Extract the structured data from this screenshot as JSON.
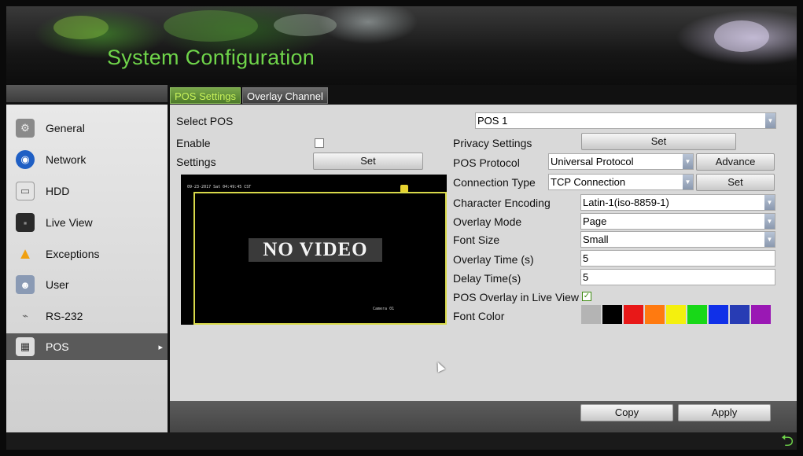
{
  "header": {
    "title": "System Configuration"
  },
  "tabs": [
    {
      "label": "POS Settings",
      "active": true
    },
    {
      "label": "Overlay Channel",
      "active": false
    }
  ],
  "sidebar": {
    "items": [
      {
        "label": "General",
        "icon": "general-icon"
      },
      {
        "label": "Network",
        "icon": "network-icon"
      },
      {
        "label": "HDD",
        "icon": "hdd-icon"
      },
      {
        "label": "Live View",
        "icon": "live-view-icon"
      },
      {
        "label": "Exceptions",
        "icon": "warning-icon"
      },
      {
        "label": "User",
        "icon": "user-icon"
      },
      {
        "label": "RS-232",
        "icon": "rs232-icon"
      },
      {
        "label": "POS",
        "icon": "pos-icon",
        "selected": true
      }
    ]
  },
  "left_form": {
    "select_pos_label": "Select POS",
    "enable_label": "Enable",
    "enable_checked": false,
    "settings_label": "Settings",
    "settings_button": "Set"
  },
  "pos_select": {
    "value": "POS 1"
  },
  "right_form": {
    "privacy_label": "Privacy Settings",
    "privacy_button": "Set",
    "protocol_label": "POS Protocol",
    "protocol_value": "Universal Protocol",
    "advance_button": "Advance",
    "connection_label": "Connection Type",
    "connection_value": "TCP Connection",
    "connection_button": "Set",
    "encoding_label": "Character Encoding",
    "encoding_value": "Latin-1(iso-8859-1)",
    "overlay_mode_label": "Overlay Mode",
    "overlay_mode_value": "Page",
    "font_size_label": "Font Size",
    "font_size_value": "Small",
    "overlay_time_label": "Overlay Time (s)",
    "overlay_time_value": "5",
    "delay_time_label": "Delay Time(s)",
    "delay_time_value": "5",
    "live_view_label": "POS Overlay in Live View",
    "live_view_checked": true,
    "font_color_label": "Font Color",
    "font_colors": [
      "#b4b4b4",
      "#000000",
      "#e81818",
      "#ff7a10",
      "#f4f00e",
      "#18d818",
      "#1030e8",
      "#283cb4",
      "#9a18b4"
    ]
  },
  "preview": {
    "no_video_text": "NO VIDEO",
    "osd_date": "09-23-2017 Sat 04:49:45 CST",
    "camera_label": "Camera 01"
  },
  "actions": {
    "copy": "Copy",
    "apply": "Apply"
  }
}
